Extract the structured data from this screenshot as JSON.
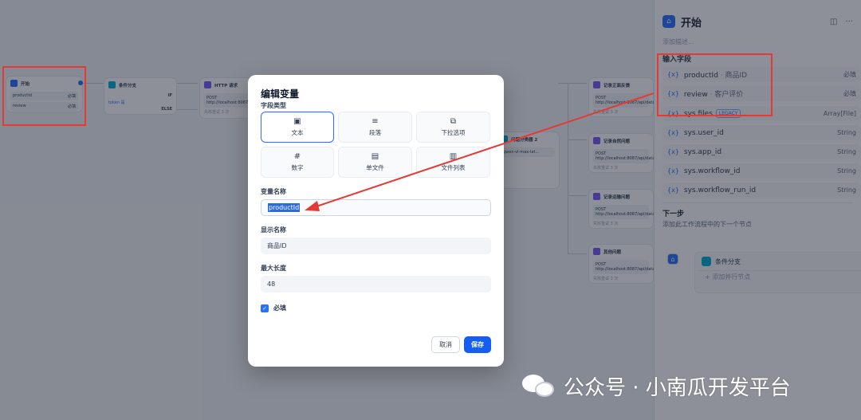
{
  "canvas": {
    "start_node": {
      "title": "开始",
      "rows": [
        {
          "name": "productId",
          "tag": "必填"
        },
        {
          "name": "review",
          "tag": "必填"
        }
      ]
    },
    "if_node": {
      "title": "条件分支",
      "if_label": "IF",
      "cond": "token 是",
      "else_label": "ELSE"
    },
    "http_node": {
      "title": "HTTP 请求",
      "method": "POST",
      "url": "http://localhost:8087/api/datasource/insert",
      "retry": "失败重试 3 次"
    },
    "llm_node": {
      "title": "问题分类器 2",
      "model": "qwen-vl-max-lat..."
    },
    "right_nodes": [
      {
        "title": "记录正面反馈",
        "method": "POST",
        "url": "http://localhost:8087/api/datasource/insert",
        "retry": "失败重试 3 次"
      },
      {
        "title": "记录自然问题",
        "method": "POST",
        "url": "http://localhost:8087/api/datasource/insert",
        "retry": "失败重试 3 次"
      },
      {
        "title": "记录运输问题",
        "method": "POST",
        "url": "http://localhost:8087/api/datasource/insert",
        "retry": "失败重试 3 次"
      },
      {
        "title": "其他问题",
        "method": "POST",
        "url": "http://localhost:8087/api/datasource/insert",
        "retry": "失败重试 3 次"
      }
    ]
  },
  "panel": {
    "title": "开始",
    "desc_placeholder": "添加描述...",
    "input_section": "输入字段",
    "inputs": [
      {
        "name": "productId",
        "display": "商品ID",
        "tag": "必填"
      },
      {
        "name": "review",
        "display": "客户评价",
        "tag": "必填"
      }
    ],
    "sys_vars": [
      {
        "name": "sys.files",
        "badge": "LEGACY",
        "type": "Array[File]"
      },
      {
        "name": "sys.user_id",
        "type": "String"
      },
      {
        "name": "sys.app_id",
        "type": "String"
      },
      {
        "name": "sys.workflow_id",
        "type": "String"
      },
      {
        "name": "sys.workflow_run_id",
        "type": "String"
      }
    ],
    "next_title": "下一步",
    "next_desc": "添加此工作流程中的下一个节点",
    "next_node": "条件分支",
    "add_parallel": "添加并行节点"
  },
  "modal": {
    "title": "编辑变量",
    "field_type_label": "字段类型",
    "types": [
      {
        "label": "文本",
        "icon": "text-icon",
        "glyph": "T",
        "active": true
      },
      {
        "label": "段落",
        "icon": "paragraph-icon",
        "glyph": "≡",
        "active": false
      },
      {
        "label": "下拉选项",
        "icon": "select-icon",
        "glyph": "⧉",
        "active": false
      },
      {
        "label": "数字",
        "icon": "number-icon",
        "glyph": "#",
        "active": false
      },
      {
        "label": "单文件",
        "icon": "file-icon",
        "glyph": "▤",
        "active": false
      },
      {
        "label": "文件列表",
        "icon": "file-list-icon",
        "glyph": "▥",
        "active": false
      }
    ],
    "var_name_label": "变量名称",
    "var_name_value": "productId",
    "display_label": "显示名称",
    "display_value": "商品ID",
    "maxlen_label": "最大长度",
    "maxlen_value": "48",
    "required_label": "必填",
    "cancel_label": "取消",
    "save_label": "保存"
  },
  "watermark": "公众号 · 小南瓜开发平台",
  "colors": {
    "accent": "#2970ff",
    "annotation": "#e53935",
    "overlay": "rgba(16,24,40,0.48)"
  }
}
